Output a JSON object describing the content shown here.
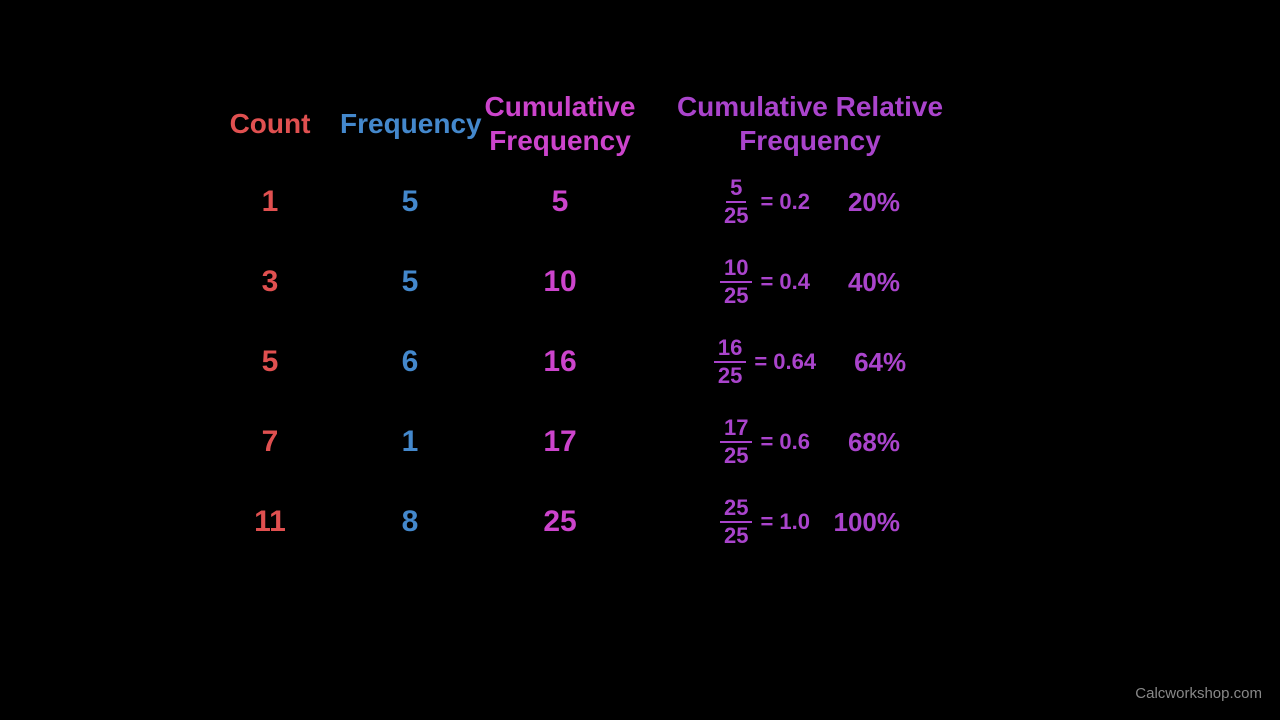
{
  "headers": {
    "count": "Count",
    "frequency": "Frequency",
    "cumulative_frequency": "Cumulative\nFrequency",
    "cumulative_relative_frequency": "Cumulative Relative\nFrequency"
  },
  "rows": [
    {
      "count": "1",
      "frequency": "5",
      "cum_freq": "5",
      "frac_num": "5",
      "frac_den": "25",
      "decimal": "= 0.2",
      "percent": "20%"
    },
    {
      "count": "3",
      "frequency": "5",
      "cum_freq": "10",
      "frac_num": "10",
      "frac_den": "25",
      "decimal": "= 0.4",
      "percent": "40%"
    },
    {
      "count": "5",
      "frequency": "6",
      "cum_freq": "16",
      "frac_num": "16",
      "frac_den": "25",
      "decimal": "= 0.64",
      "percent": "64%"
    },
    {
      "count": "7",
      "frequency": "1",
      "cum_freq": "17",
      "frac_num": "17",
      "frac_den": "25",
      "decimal": "= 0.6",
      "percent": "68%"
    },
    {
      "count": "11",
      "frequency": "8",
      "cum_freq": "25",
      "frac_num": "25",
      "frac_den": "25",
      "decimal": "= 1.0",
      "percent": "100%"
    }
  ],
  "watermark": "Calcworkshop.com"
}
